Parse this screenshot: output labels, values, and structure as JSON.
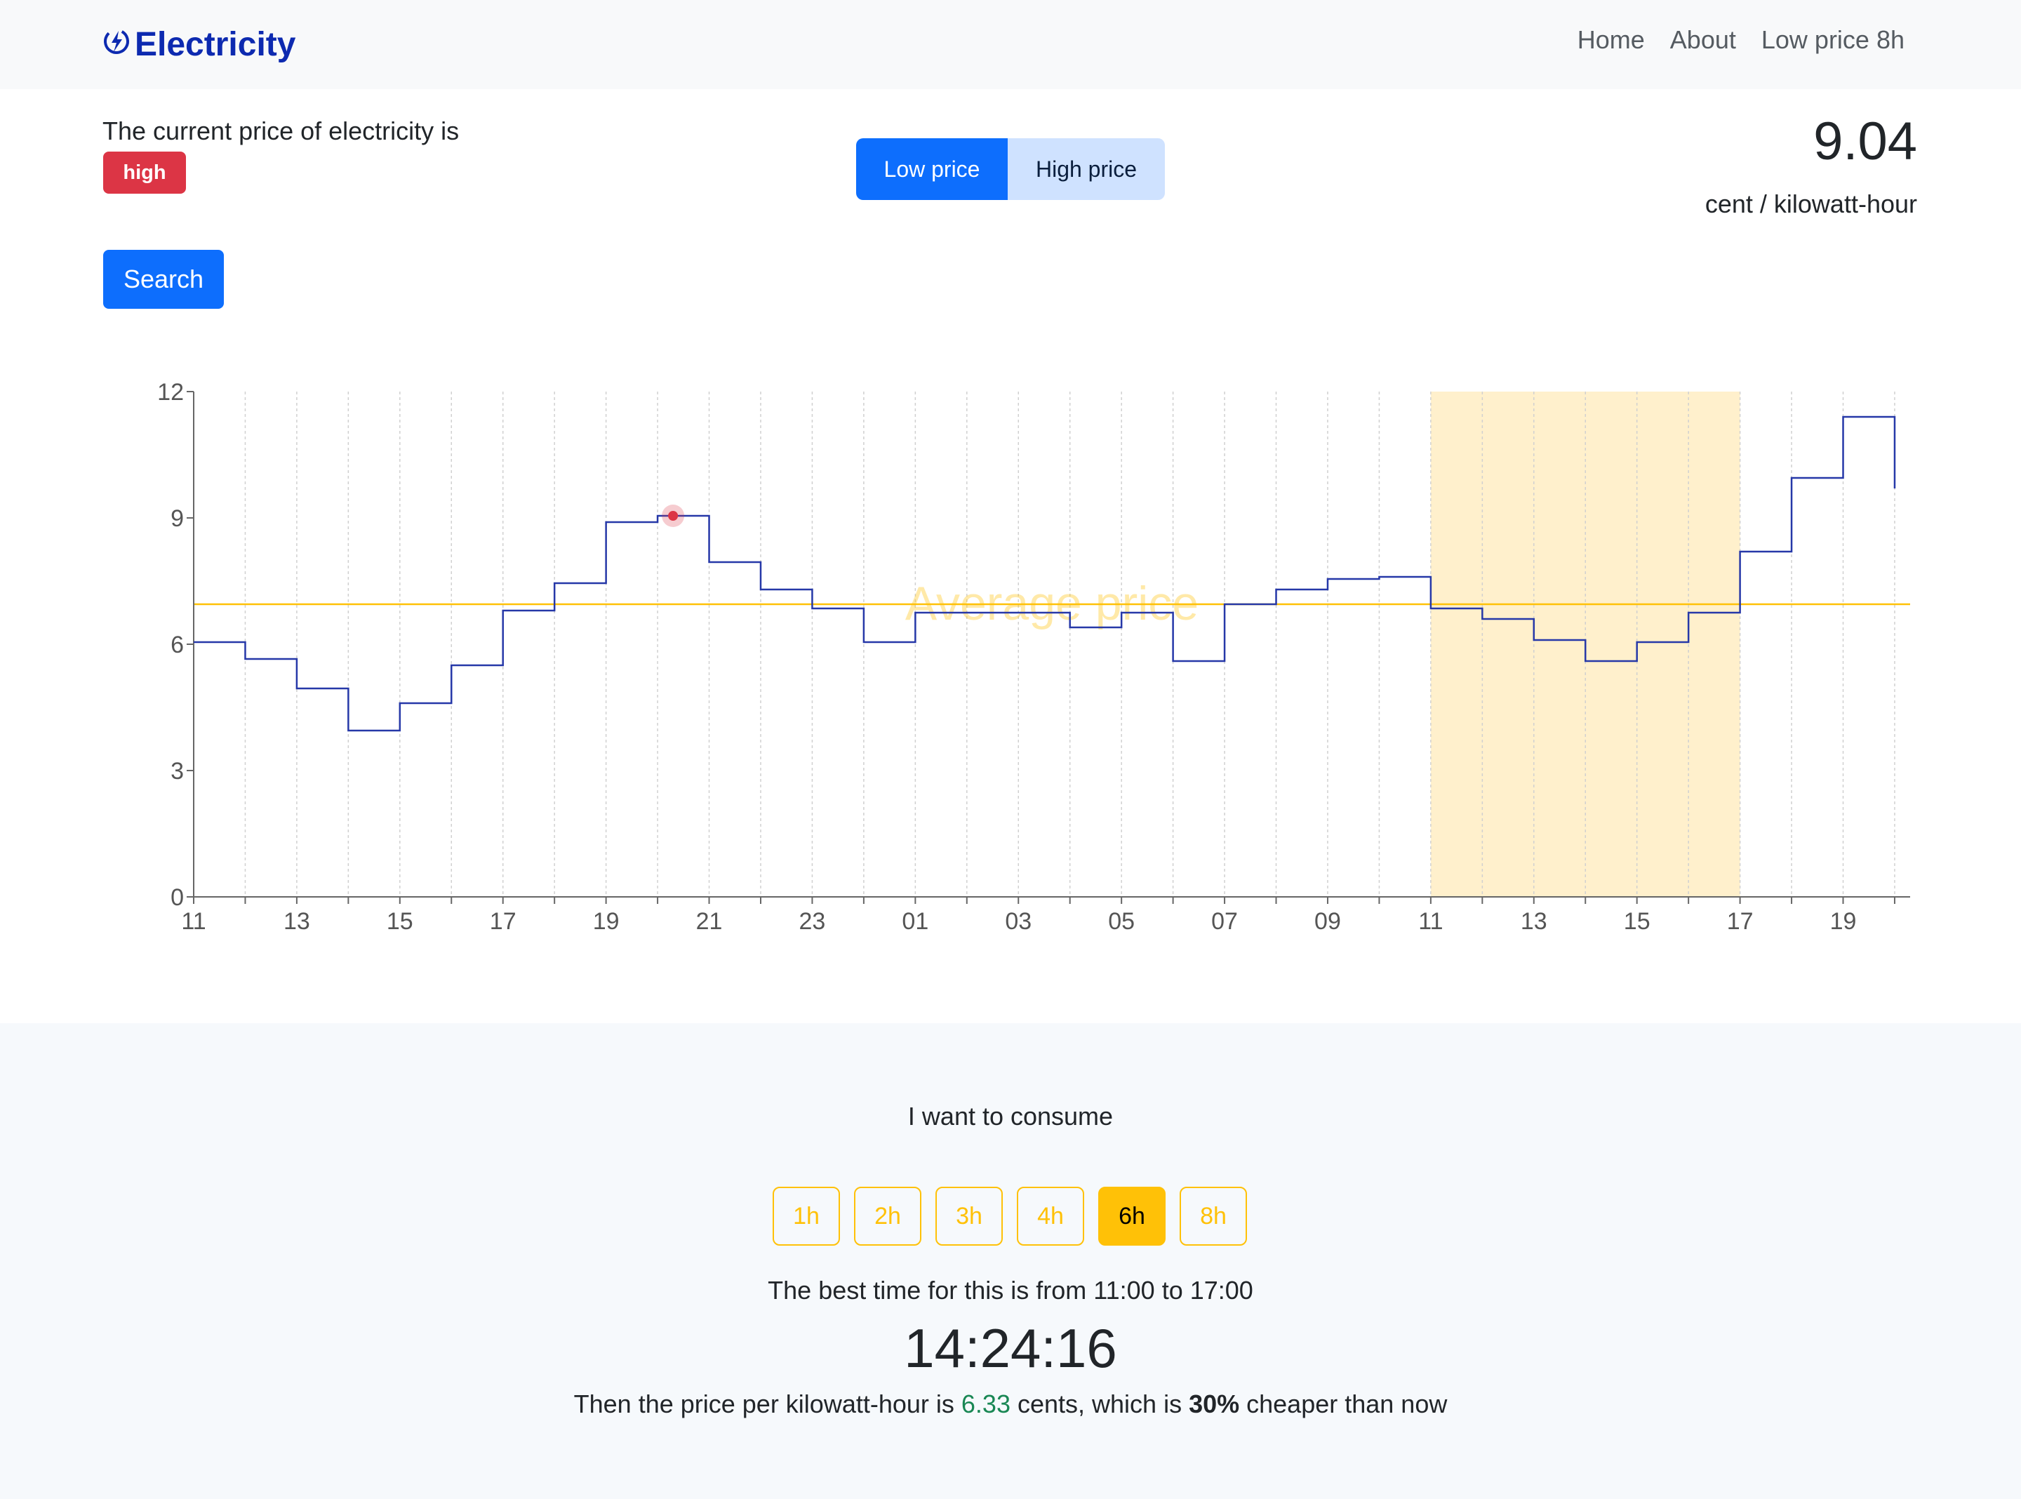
{
  "navbar": {
    "brand": "Electricity",
    "links": [
      "Home",
      "About",
      "Low price 8h"
    ]
  },
  "current": {
    "text": "The current price of electricity is",
    "badge": "high",
    "price": "9.04",
    "unit": "cent / kilowatt-hour"
  },
  "toggle": {
    "low_label": "Low price",
    "high_label": "High price",
    "selected": "Low price"
  },
  "search": {
    "label": "Search"
  },
  "colors": {
    "line": "#2638a8",
    "average": "#ffc107",
    "highlight": "#fff0cc",
    "current_point": "#dc3545",
    "primary": "#0d6efd",
    "danger": "#dc3545",
    "success": "#198754"
  },
  "chart_data": {
    "type": "line",
    "step": true,
    "x_labels": [
      "11",
      "13",
      "15",
      "17",
      "19",
      "21",
      "23",
      "01",
      "03",
      "05",
      "07",
      "09",
      "11",
      "13",
      "15",
      "17",
      "19"
    ],
    "x_start_hour": 11,
    "values": [
      6.05,
      5.65,
      4.95,
      3.95,
      4.6,
      5.5,
      6.8,
      7.45,
      8.9,
      9.05,
      7.95,
      7.3,
      6.85,
      6.05,
      6.75,
      6.75,
      6.75,
      6.4,
      6.75,
      5.6,
      6.95,
      7.3,
      7.55,
      7.6,
      6.85,
      6.6,
      6.1,
      5.6,
      6.05,
      6.75,
      8.2,
      9.95,
      11.4,
      9.7
    ],
    "ylim": [
      0,
      12
    ],
    "yticks": [
      0,
      3,
      6,
      9,
      12
    ],
    "average": 6.95,
    "average_label": "Average price",
    "highlight_hours": [
      24,
      30
    ],
    "current_point": {
      "hour": 9.3,
      "value": 9.05
    },
    "grid_x": true
  },
  "consume": {
    "label": "I want to consume",
    "durations": [
      "1h",
      "2h",
      "3h",
      "4h",
      "6h",
      "8h"
    ],
    "selected": "6h",
    "best_time": "The best time for this is from 11:00 to 17:00",
    "countdown": "14:24:16",
    "price_prefix": "Then the price per kilowatt-hour is ",
    "price_value": "6.33",
    "price_middle": " cents, which is ",
    "percent": "30%",
    "price_suffix": " cheaper than now"
  }
}
